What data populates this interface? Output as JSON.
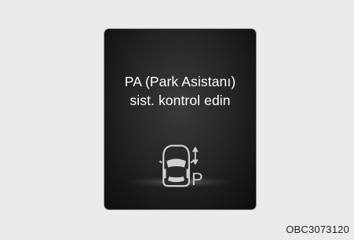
{
  "display": {
    "message_line_1": "PA (Park Asistanı)",
    "message_line_2": "sist. kontrol edin",
    "indicator_letter": "P",
    "icons": [
      "car-top-view-icon",
      "up-down-arrow-icon"
    ]
  },
  "image_code": "OBC3073120",
  "colors": {
    "page_background": "#ebebeb",
    "display_background": "#1a1a1a",
    "text": "#ffffff",
    "icon": "#cfcfcf"
  }
}
